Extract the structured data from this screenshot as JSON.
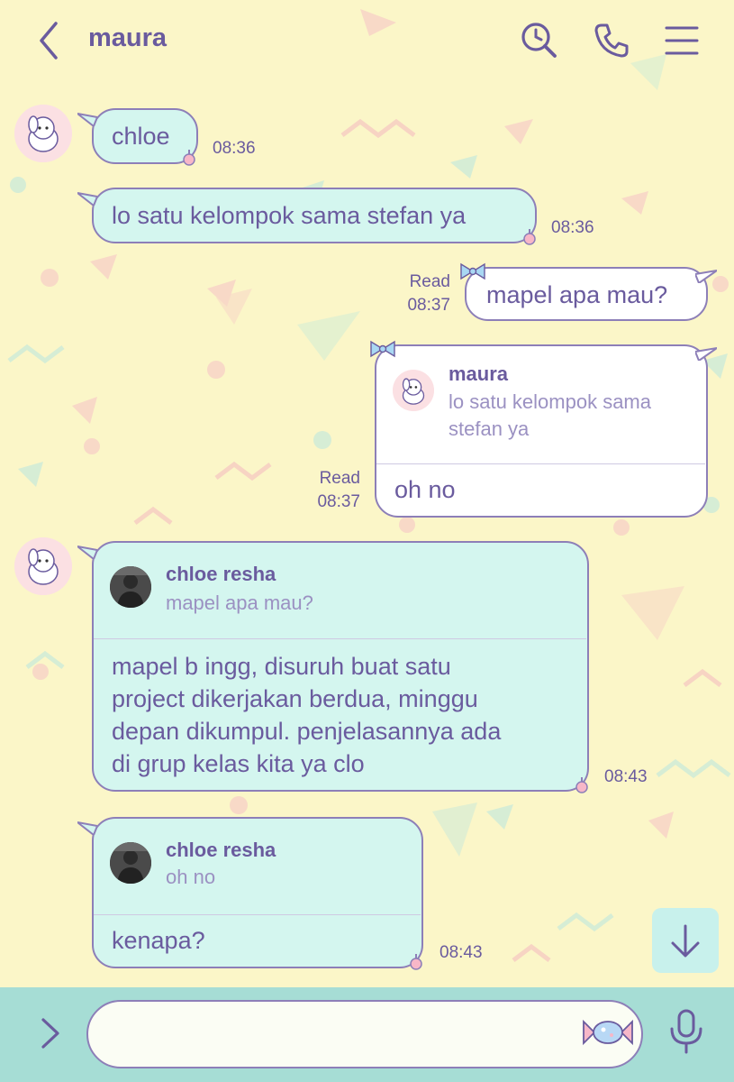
{
  "header": {
    "title": "maura",
    "icons": [
      "chevron-left-icon",
      "search-clock-icon",
      "phone-icon",
      "menu-icon"
    ]
  },
  "messages": [
    {
      "side": "in",
      "text": "chloe",
      "time": "08:36"
    },
    {
      "side": "in",
      "text": "lo satu kelompok sama stefan ya",
      "time": "08:36"
    },
    {
      "side": "out",
      "status": "Read",
      "time": "08:37",
      "text": "mapel apa mau?"
    },
    {
      "side": "out",
      "status": "Read",
      "time": "08:37",
      "reply": {
        "name": "maura",
        "text": "lo satu kelompok sama stefan ya"
      },
      "text": "oh no"
    },
    {
      "side": "in",
      "time": "08:43",
      "reply": {
        "name": "chloe resha",
        "text": "mapel apa mau?"
      },
      "lines": [
        "mapel b ingg, disuruh buat satu",
        "project dikerjakan berdua, minggu",
        "depan dikumpul. penjelasannya ada",
        "di grup kelas kita ya clo"
      ]
    },
    {
      "side": "in",
      "time": "08:43",
      "reply": {
        "name": "chloe resha",
        "text": "oh no"
      },
      "text": "kenapa?"
    }
  ],
  "input": {
    "placeholder": "",
    "value": ""
  },
  "colors": {
    "background": "#fbf6c8",
    "bubble_in": "#d4f6ef",
    "bubble_out": "#ffffff",
    "border": "#8d7fb8",
    "text": "#6a5b9e",
    "bottom_bar": "#a6ddd5"
  }
}
